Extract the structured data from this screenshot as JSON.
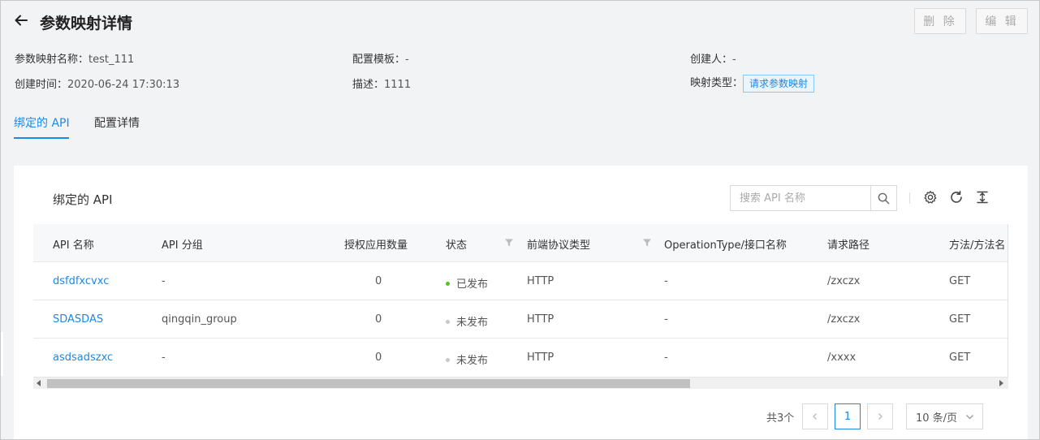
{
  "header": {
    "title": "参数映射详情",
    "delete_label": "删 除",
    "edit_label": "编 辑"
  },
  "info": {
    "name_label": "参数映射名称：",
    "name_value": "test_111",
    "template_label": "配置模板：",
    "template_value": "-",
    "creator_label": "创建人：",
    "creator_value": "-",
    "created_label": "创建时间：",
    "created_value": "2020-06-24 17:30:13",
    "desc_label": "描述：",
    "desc_value": "1111",
    "type_label": "映射类型：",
    "type_value": "请求参数映射"
  },
  "tabs": [
    {
      "label": "绑定的 API",
      "active": true
    },
    {
      "label": "配置详情",
      "active": false
    }
  ],
  "card": {
    "title": "绑定的 API",
    "search_placeholder": "搜索 API 名称"
  },
  "table": {
    "columns": [
      "API 名称",
      "API 分组",
      "授权应用数量",
      "状态",
      "前端协议类型",
      "OperationType/接口名称",
      "请求路径",
      "方法/方法名"
    ],
    "rows": [
      {
        "name": "dsfdfxcvxc",
        "group": "-",
        "apps": "0",
        "status": "已发布",
        "status_color": "#52c41a",
        "protocol": "HTTP",
        "operation": "-",
        "path": "/zxczx",
        "method": "GET"
      },
      {
        "name": "SDASDAS",
        "group": "qingqin_group",
        "apps": "0",
        "status": "未发布",
        "status_color": "#c8c8c8",
        "protocol": "HTTP",
        "operation": "-",
        "path": "/zxczx",
        "method": "GET"
      },
      {
        "name": "asdsadszxc",
        "group": "-",
        "apps": "0",
        "status": "未发布",
        "status_color": "#c8c8c8",
        "protocol": "HTTP",
        "operation": "-",
        "path": "/xxxx",
        "method": "GET"
      }
    ]
  },
  "pagination": {
    "total": "共3个",
    "current": "1",
    "page_size": "10 条/页"
  },
  "colors": {
    "accent": "#1e88e5",
    "published": "#52c41a",
    "unpublished": "#c8c8c8"
  }
}
